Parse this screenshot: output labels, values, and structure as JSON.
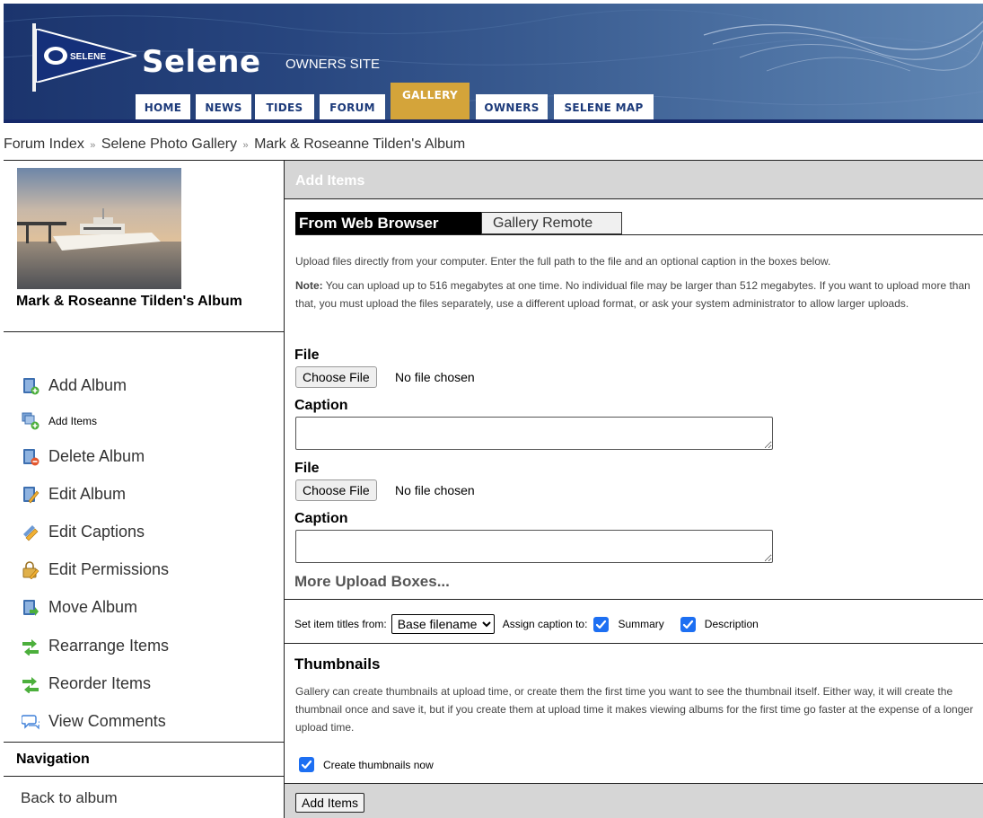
{
  "header": {
    "pennant_text": "SELENE",
    "site_title": "Selene",
    "site_subtitle": "OWNERS SITE",
    "tabs": [
      {
        "label": "HOME",
        "active": false
      },
      {
        "label": "NEWS",
        "active": false
      },
      {
        "label": "TIDES",
        "active": false
      },
      {
        "label": "FORUM",
        "active": false
      },
      {
        "label": "GALLERY",
        "active": true
      },
      {
        "label": "OWNERS",
        "active": false
      },
      {
        "label": "SELENE MAP",
        "active": false
      }
    ]
  },
  "breadcrumb": {
    "items": [
      "Forum Index",
      "Selene Photo Gallery",
      "Mark & Roseanne Tilden's Album"
    ],
    "separator": "»"
  },
  "sidebar": {
    "album_name": "Mark & Roseanne Tilden's Album",
    "menu": [
      {
        "label": "Add Album",
        "icon": "add-album-icon"
      },
      {
        "label": "Add Items",
        "icon": "add-items-icon"
      },
      {
        "label": "Delete Album",
        "icon": "delete-album-icon"
      },
      {
        "label": "Edit Album",
        "icon": "edit-album-icon"
      },
      {
        "label": "Edit Captions",
        "icon": "edit-captions-icon"
      },
      {
        "label": "Edit Permissions",
        "icon": "edit-permissions-icon"
      },
      {
        "label": "Move Album",
        "icon": "move-album-icon"
      },
      {
        "label": "Rearrange Items",
        "icon": "rearrange-items-icon"
      },
      {
        "label": "Reorder Items",
        "icon": "reorder-items-icon"
      },
      {
        "label": "View Comments",
        "icon": "view-comments-icon"
      }
    ],
    "navigation_heading": "Navigation",
    "back_link": "Back to album"
  },
  "main": {
    "section_title": "Add Items",
    "tabs": {
      "active": "From Web Browser",
      "inactive": "Gallery Remote"
    },
    "intro": "Upload files directly from your computer. Enter the full path to the file and an optional caption in the boxes below.",
    "note_label": "Note:",
    "note": " You can upload up to 516 megabytes at one time. No individual file may be larger than 512 megabytes. If you want to upload more than that, you must upload the files separately, use a different upload format, or ask your system administrator to allow larger uploads.",
    "file_label": "File",
    "choose_file": "Choose File",
    "no_file": "No file chosen",
    "caption_label": "Caption",
    "more_boxes": "More Upload Boxes...",
    "set_titles_label": "Set item titles from:",
    "title_source": "Base filename",
    "assign_caption_label": "Assign caption to:",
    "summary_label": "Summary",
    "description_label": "Description",
    "summary_checked": true,
    "description_checked": true,
    "thumbnails_heading": "Thumbnails",
    "thumbnails_text": "Gallery can create thumbnails at upload time, or create them the first time you want to see the thumbnail itself. Either way, it will create the thumbnail once and save it, but if you create them at upload time it makes viewing albums for the first time go faster at the expense of a longer upload time.",
    "create_thumbnails_label": "Create thumbnails now",
    "create_thumbnails_checked": true,
    "submit_label": "Add Items"
  },
  "colors": {
    "header_bg": "#1f3a75",
    "tab_text": "#1c3a7a",
    "active_tab": "#d4a43a",
    "section_bar": "#d6d6d6",
    "checkbox": "#1d6ff2"
  }
}
